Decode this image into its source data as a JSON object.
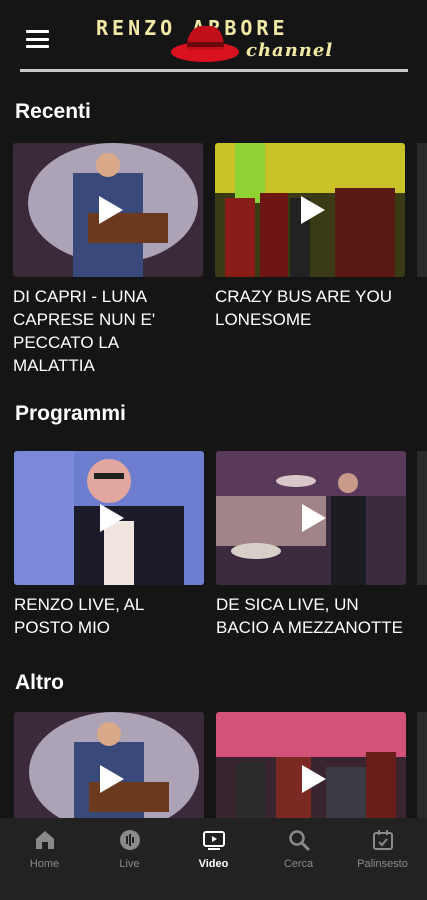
{
  "header": {
    "menu_icon": "hamburger-icon",
    "logo_top": "RENZO ARBORE",
    "logo_sub": "channel"
  },
  "sections": [
    {
      "title": "Recenti",
      "items": [
        {
          "title": "DI CAPRI - LUNA CAPRESE NUN E' PECCATO LA MALATTIA"
        },
        {
          "title": "CRAZY BUS ARE YOU LONESOME"
        }
      ]
    },
    {
      "title": "Programmi",
      "items": [
        {
          "title": "RENZO LIVE, AL POSTO MIO"
        },
        {
          "title": "DE SICA LIVE, UN BACIO A MEZZANOTTE"
        }
      ]
    },
    {
      "title": "Altro",
      "items": [
        {
          "title": ""
        },
        {
          "title": ""
        }
      ]
    }
  ],
  "tabs": [
    {
      "label": "Home",
      "icon": "home-icon"
    },
    {
      "label": "Live",
      "icon": "live-icon"
    },
    {
      "label": "Video",
      "icon": "video-icon",
      "active": true
    },
    {
      "label": "Cerca",
      "icon": "search-icon"
    },
    {
      "label": "Palinsesto",
      "icon": "calendar-icon"
    }
  ],
  "colors": {
    "background": "#151515",
    "tabbar": "#222222",
    "logo": "#f2e9a5",
    "hat": "#d8121e"
  }
}
